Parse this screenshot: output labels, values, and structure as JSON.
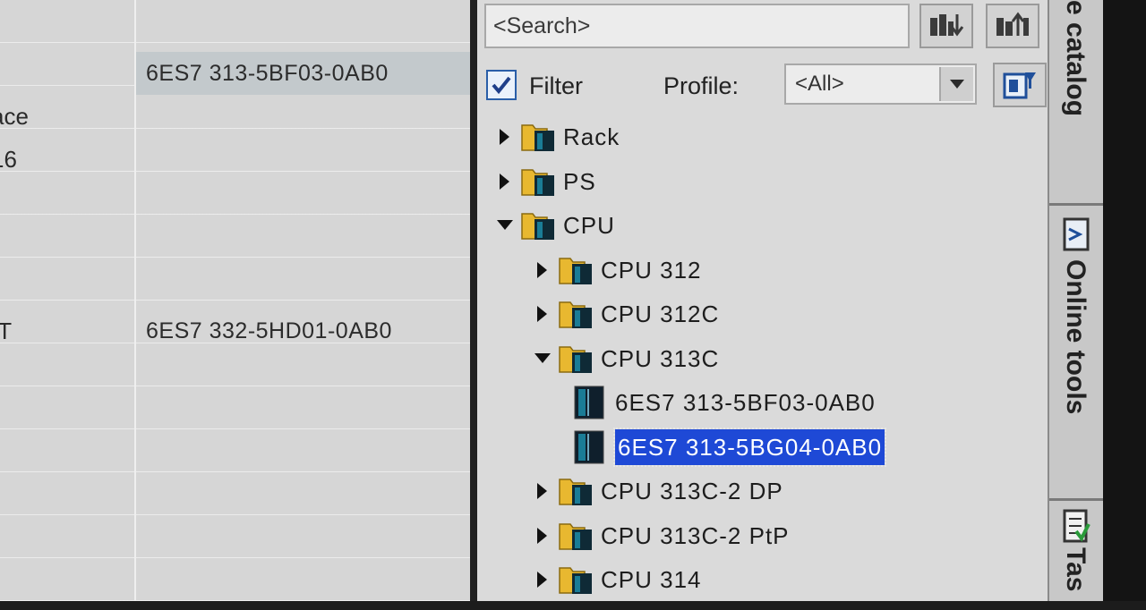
{
  "left_table": {
    "rows": [
      {
        "label": "",
        "value": ""
      },
      {
        "label": "",
        "value": "6ES7 313-5BF03-0AB0",
        "highlight": true
      },
      {
        "label": "ace",
        "value": ""
      },
      {
        "label": "16",
        "value": ""
      },
      {
        "label": "",
        "value": ""
      },
      {
        "label": "",
        "value": ""
      },
      {
        "label": "",
        "value": ""
      },
      {
        "label": "IT",
        "value": "6ES7 332-5HD01-0AB0"
      },
      {
        "label": "",
        "value": ""
      },
      {
        "label": "",
        "value": ""
      },
      {
        "label": "",
        "value": ""
      },
      {
        "label": "",
        "value": ""
      },
      {
        "label": "",
        "value": ""
      },
      {
        "label": "",
        "value": ""
      }
    ]
  },
  "catalog": {
    "search_placeholder": "<Search>",
    "filter_label": "Filter",
    "filter_checked": true,
    "profile_label": "Profile:",
    "profile_value": "<All>",
    "tree": [
      {
        "label": "Rack",
        "level": 0,
        "type": "folder",
        "expanded": false
      },
      {
        "label": "PS",
        "level": 0,
        "type": "folder",
        "expanded": false
      },
      {
        "label": "CPU",
        "level": 0,
        "type": "folder",
        "expanded": true
      },
      {
        "label": "CPU 312",
        "level": 1,
        "type": "folder",
        "expanded": false
      },
      {
        "label": "CPU 312C",
        "level": 1,
        "type": "folder",
        "expanded": false
      },
      {
        "label": "CPU 313C",
        "level": 1,
        "type": "folder",
        "expanded": true
      },
      {
        "label": "6ES7 313-5BF03-0AB0",
        "level": 2,
        "type": "module"
      },
      {
        "label": "6ES7 313-5BG04-0AB0",
        "level": 2,
        "type": "module",
        "selected": true
      },
      {
        "label": "CPU 313C-2 DP",
        "level": 1,
        "type": "folder",
        "expanded": false
      },
      {
        "label": "CPU 313C-2 PtP",
        "level": 1,
        "type": "folder",
        "expanded": false
      },
      {
        "label": "CPU 314",
        "level": 1,
        "type": "folder",
        "expanded": false
      }
    ]
  },
  "side_tabs": {
    "catalog_label": "e catalog",
    "online_tools_label": "Online tools",
    "tasks_label": "Tas"
  },
  "colors": {
    "selection": "#1e49d6",
    "checkbox_accent": "#2a5ea8",
    "folder": "#e8b830",
    "module": "#1a7c96"
  },
  "icons": [
    "search-down-icon",
    "search-up-icon",
    "filter-profile-icon",
    "folder-icon",
    "module-icon",
    "expand-arrow-icon",
    "collapse-arrow-icon",
    "online-tools-icon",
    "tasks-icon"
  ]
}
